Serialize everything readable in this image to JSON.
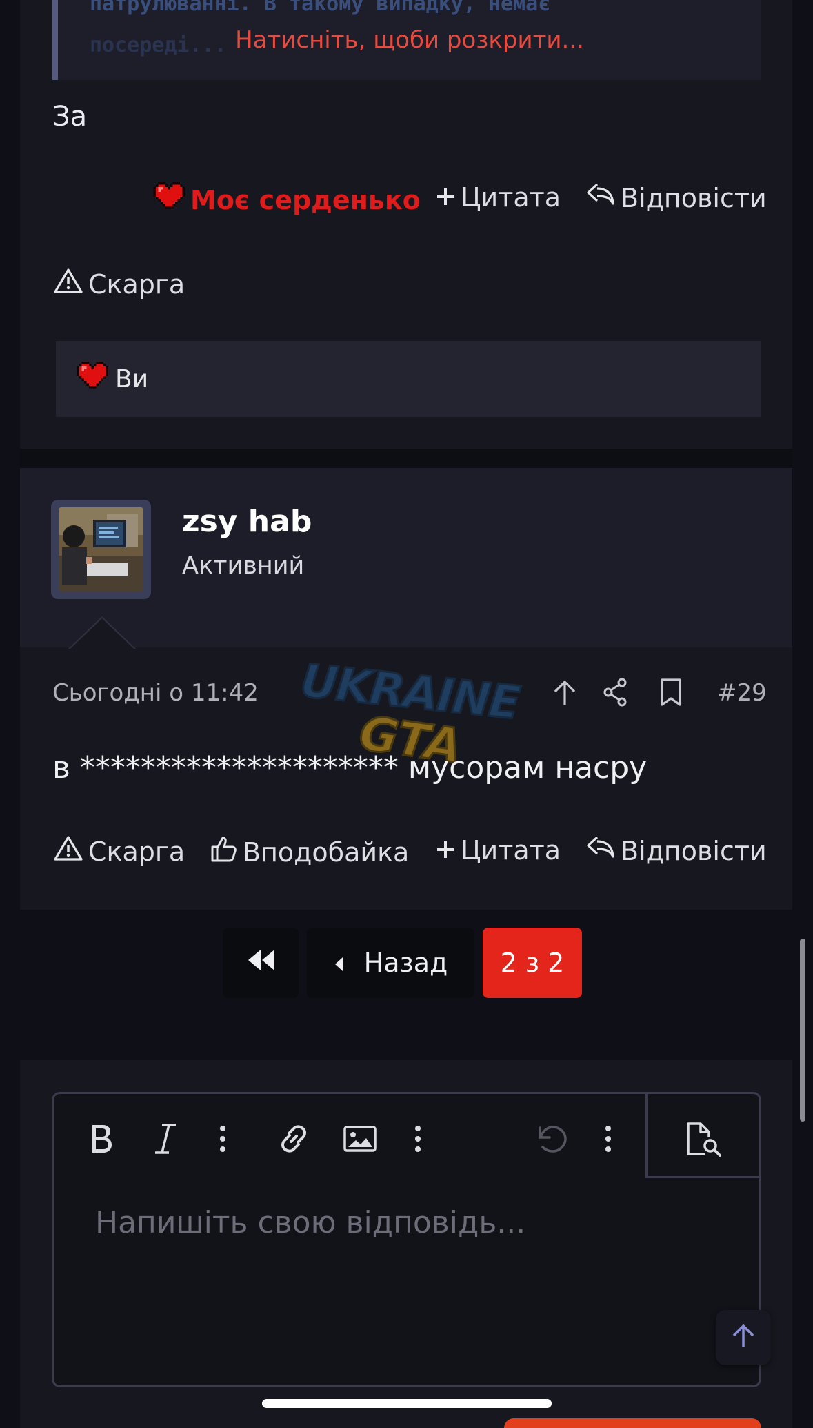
{
  "post1": {
    "spoiler_code_line1": "патрулюванні. В такому випадку, немає",
    "spoiler_code_line2": "посереді...",
    "spoiler_reveal": "Натисніть, щоби розкрити...",
    "text": "За",
    "reaction_label": "Моє серденько",
    "quote_label": "Цитата",
    "reply_label": "Відповісти",
    "report_label": "Скарга",
    "reactions_by": "Ви"
  },
  "post2": {
    "username": "zsy hab",
    "user_title": "Активний",
    "date": "Сьогодні о 11:42",
    "number": "#29",
    "text": "в ********************* мусорам насру",
    "report_label": "Скарга",
    "like_label": "Вподобайка",
    "quote_label": "Цитата",
    "reply_label": "Відповісти"
  },
  "watermark": {
    "line1": "UKRAINE",
    "line2": "GTA"
  },
  "pagination": {
    "back_label": "Назад",
    "current": "2 з 2"
  },
  "editor": {
    "placeholder": "Напишіть свою відповідь..."
  },
  "colors": {
    "accent_red": "#e3251b",
    "heart_red": "#e01b1b",
    "background": "#0f1017",
    "card": "#17181f"
  },
  "icons": [
    "warning-icon",
    "heart-icon",
    "plus-icon",
    "reply-icon",
    "arrow-up-icon",
    "share-icon",
    "bookmark-icon",
    "thumbs-up-icon",
    "bold-icon",
    "italic-icon",
    "more-vertical-icon",
    "link-icon",
    "image-icon",
    "undo-icon",
    "preview-icon",
    "first-page-icon",
    "caret-left-icon"
  ]
}
